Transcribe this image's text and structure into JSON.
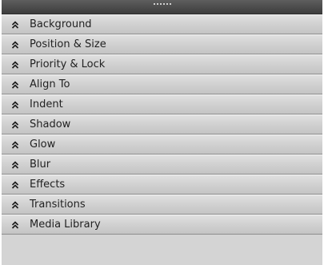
{
  "panel": {
    "sections": [
      {
        "label": "Background",
        "icon": "double-chevron-up-icon"
      },
      {
        "label": "Position & Size",
        "icon": "double-chevron-up-icon"
      },
      {
        "label": "Priority & Lock",
        "icon": "double-chevron-up-icon"
      },
      {
        "label": "Align To",
        "icon": "double-chevron-up-icon"
      },
      {
        "label": "Indent",
        "icon": "double-chevron-up-icon"
      },
      {
        "label": "Shadow",
        "icon": "double-chevron-up-icon"
      },
      {
        "label": "Glow",
        "icon": "double-chevron-up-icon"
      },
      {
        "label": "Blur",
        "icon": "double-chevron-up-icon"
      },
      {
        "label": "Effects",
        "icon": "double-chevron-up-icon"
      },
      {
        "label": "Transitions",
        "icon": "double-chevron-up-icon"
      },
      {
        "label": "Media Library",
        "icon": "double-chevron-up-icon"
      }
    ]
  },
  "colors": {
    "header_bar": "#4a4a4a",
    "section_bg": "#d2d2d2",
    "text": "#222222"
  }
}
